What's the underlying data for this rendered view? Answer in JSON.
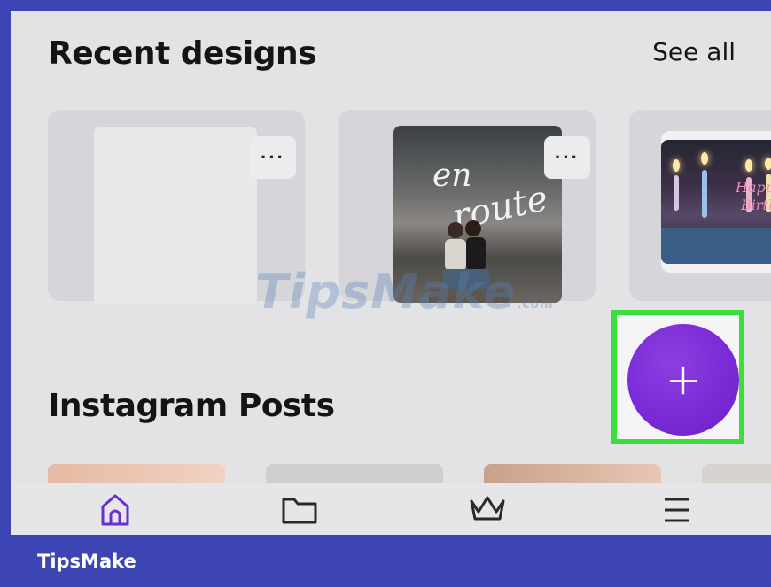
{
  "screen": {
    "recent_title": "Recent designs",
    "see_all_label": "See all",
    "instagram_title": "Instagram Posts"
  },
  "cards": {
    "more_label": "···",
    "design2_script_line1": "en",
    "design2_script_line2": "route",
    "design3_script_line1": "Happy",
    "design3_script_line2": "Birthday"
  },
  "fab": {
    "label": "+"
  },
  "watermark": {
    "text": "TipsMake",
    "suffix": ".com"
  },
  "footer": {
    "brand": "TipsMake"
  },
  "colors": {
    "frame": "#3d44b4",
    "accent_purple": "#7a2bd6",
    "highlight_green": "#3adf3a"
  },
  "nav": {
    "items": [
      {
        "icon": "home-icon"
      },
      {
        "icon": "folder-icon"
      },
      {
        "icon": "crown-icon"
      },
      {
        "icon": "menu-icon"
      }
    ]
  }
}
